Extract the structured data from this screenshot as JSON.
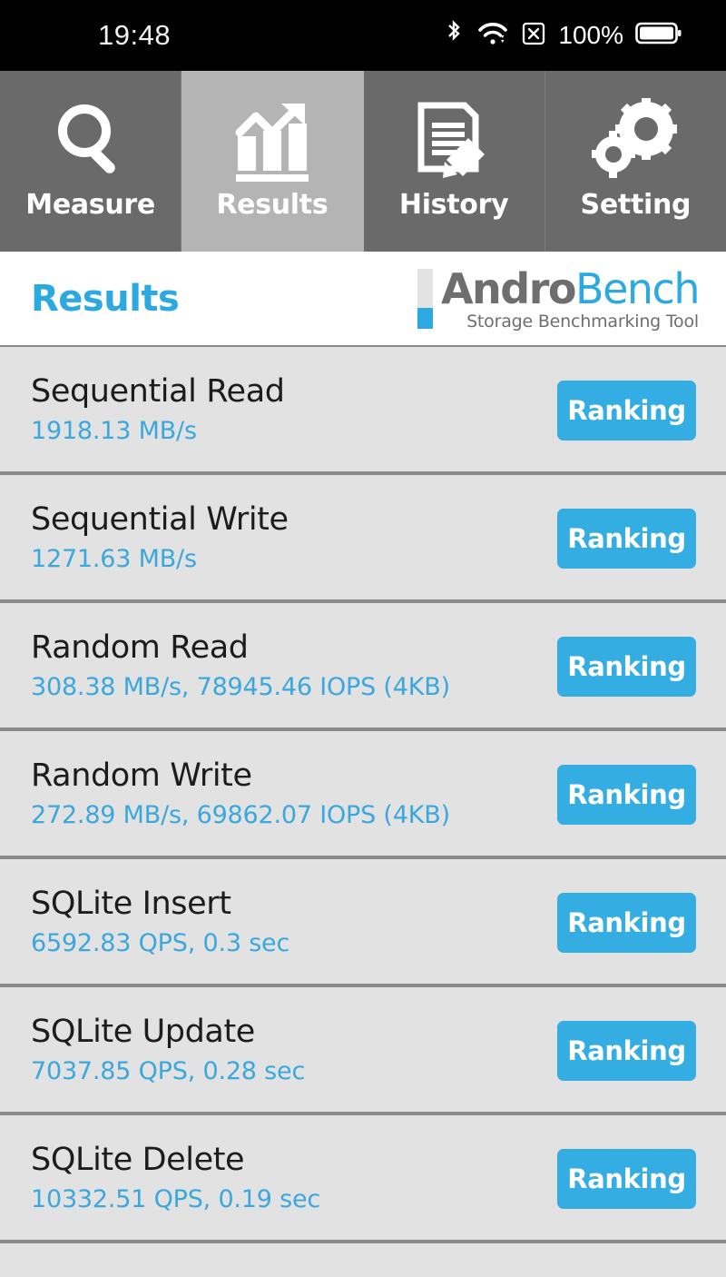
{
  "statusbar": {
    "time": "19:48",
    "battery_percent": "100%",
    "icons": [
      "bluetooth-icon",
      "wifi-icon",
      "sim-card-off-icon",
      "battery-icon"
    ]
  },
  "tabs": [
    {
      "label": "Measure",
      "icon": "magnifier-icon",
      "active": false
    },
    {
      "label": "Results",
      "icon": "bar-chart-trend-icon",
      "active": true
    },
    {
      "label": "History",
      "icon": "document-pencil-icon",
      "active": false
    },
    {
      "label": "Setting",
      "icon": "gears-icon",
      "active": false
    }
  ],
  "header": {
    "title": "Results",
    "logo_primary": "Andro",
    "logo_secondary": "Bench",
    "logo_subtitle": "Storage Benchmarking Tool"
  },
  "results": [
    {
      "name": "Sequential Read",
      "value": "1918.13 MB/s",
      "button": "Ranking"
    },
    {
      "name": "Sequential Write",
      "value": "1271.63 MB/s",
      "button": "Ranking"
    },
    {
      "name": "Random Read",
      "value": "308.38 MB/s, 78945.46 IOPS (4KB)",
      "button": "Ranking"
    },
    {
      "name": "Random Write",
      "value": "272.89 MB/s, 69862.07 IOPS (4KB)",
      "button": "Ranking"
    },
    {
      "name": "SQLite Insert",
      "value": "6592.83 QPS, 0.3 sec",
      "button": "Ranking"
    },
    {
      "name": "SQLite Update",
      "value": "7037.85 QPS, 0.28 sec",
      "button": "Ranking"
    },
    {
      "name": "SQLite Delete",
      "value": "10332.51 QPS, 0.19 sec",
      "button": "Ranking"
    }
  ],
  "colors": {
    "accent_blue": "#2ba9e0",
    "button_blue": "#33ade2",
    "value_blue": "#3aa8dd",
    "tab_inactive": "#6a6a6a",
    "tab_active": "#b4b4b4",
    "list_bg": "#e2e2e2",
    "logo_gray": "#6e6e6e"
  }
}
